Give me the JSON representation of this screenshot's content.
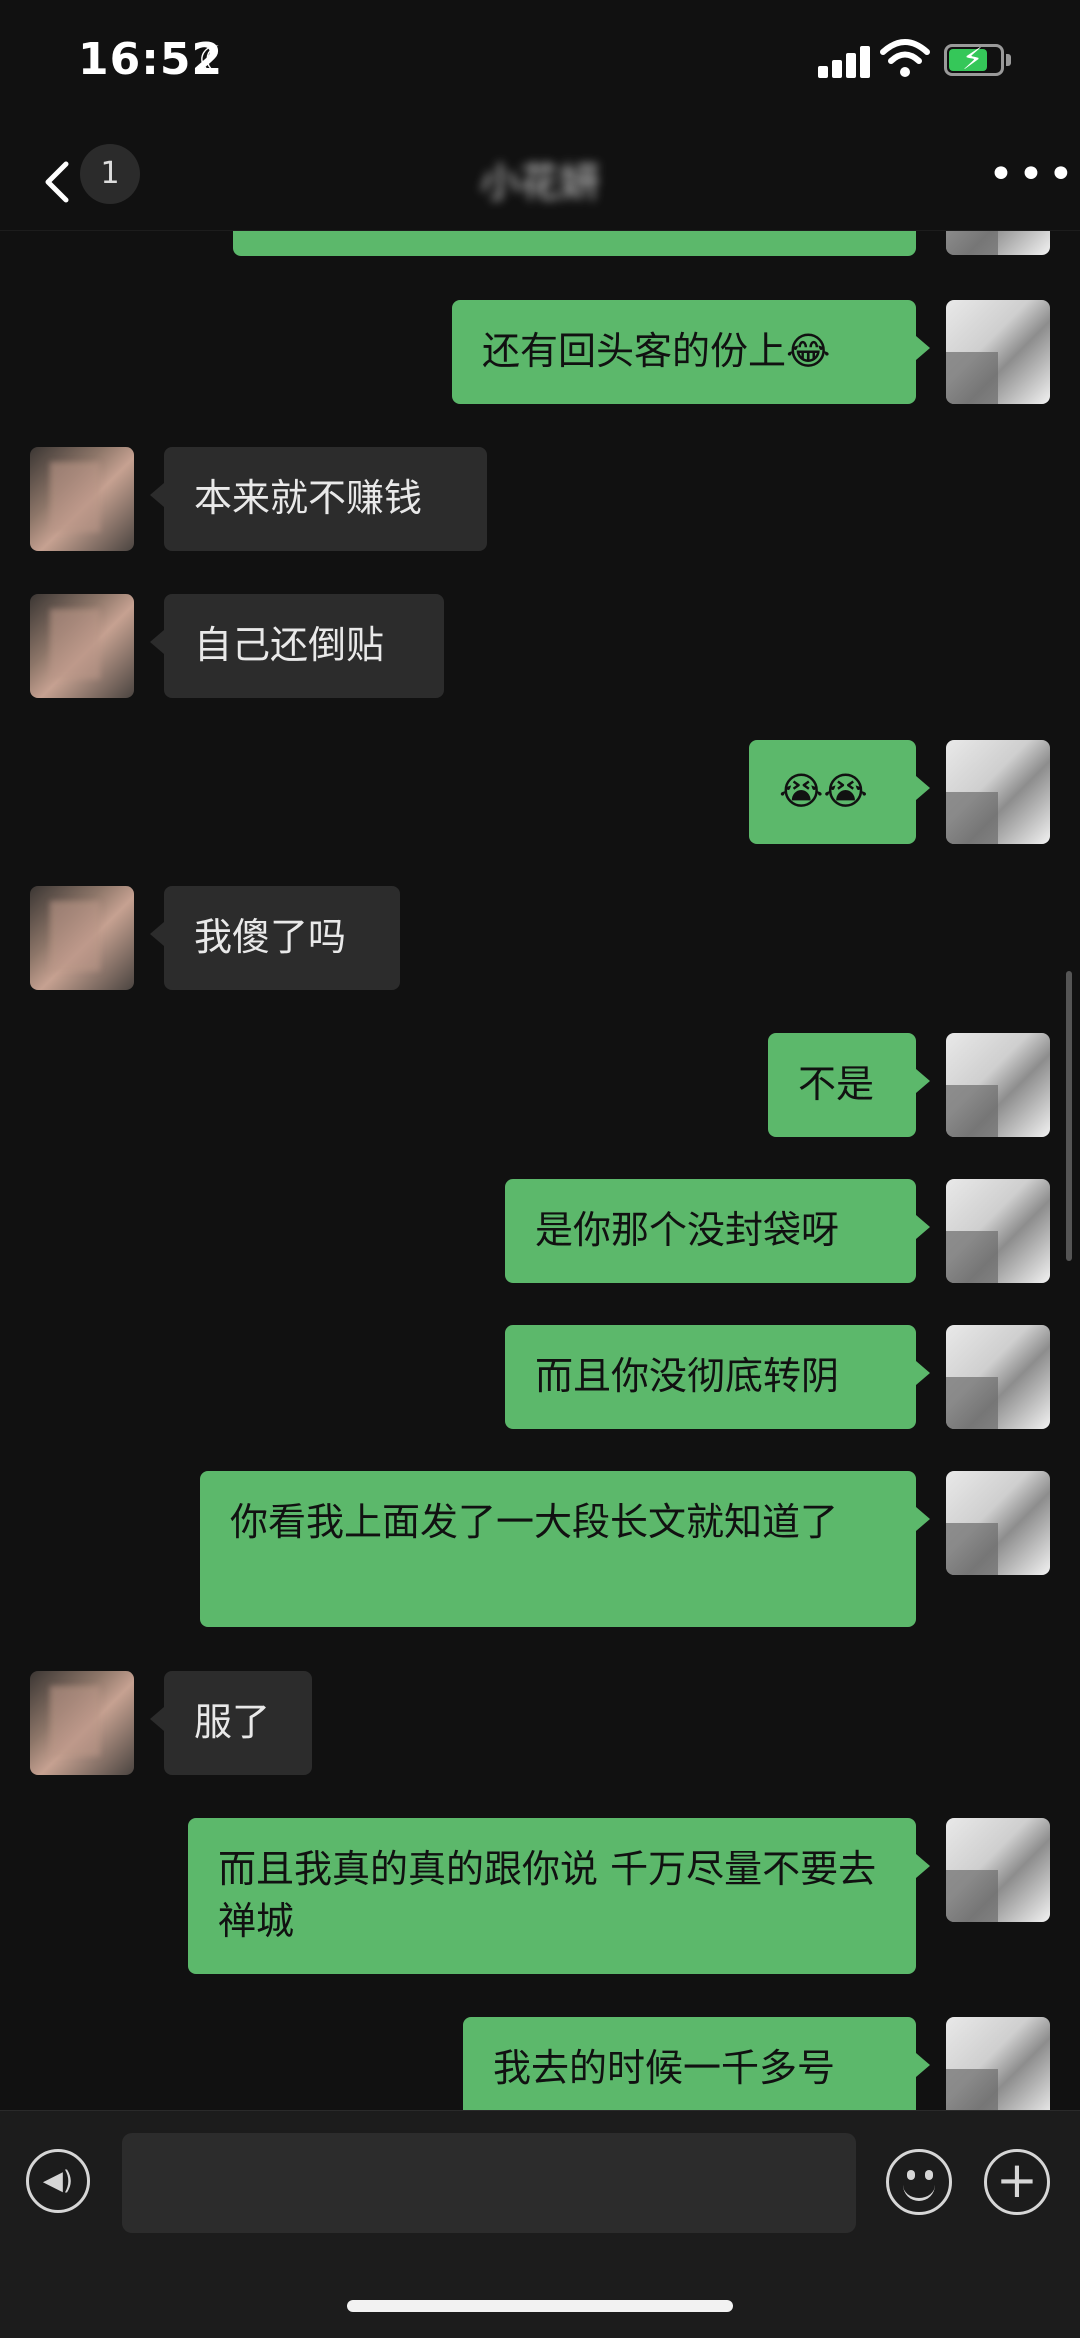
{
  "status": {
    "time": "16:52"
  },
  "nav": {
    "back_count": "1",
    "title": "小花妍"
  },
  "messages": [
    {
      "side": "me",
      "text": ""
    },
    {
      "side": "me",
      "text": "还有回头客的份上😂"
    },
    {
      "side": "them",
      "text": "本来就不赚钱"
    },
    {
      "side": "them",
      "text": "自己还倒贴"
    },
    {
      "side": "me",
      "text": "😭😭"
    },
    {
      "side": "them",
      "text": "我傻了吗"
    },
    {
      "side": "me",
      "text": "不是"
    },
    {
      "side": "me",
      "text": "是你那个没封袋呀"
    },
    {
      "side": "me",
      "text": "而且你没彻底转阴"
    },
    {
      "side": "me",
      "text": "你看我上面发了一大段长文就知道了"
    },
    {
      "side": "them",
      "text": "服了"
    },
    {
      "side": "me",
      "text": "而且我真的真的跟你说 千万尽量不要去禅城"
    },
    {
      "side": "me",
      "text": "我去的时候一千多号"
    }
  ],
  "colors": {
    "bubble_me": "#5cb86b",
    "bubble_them": "#2c2c2c",
    "bg": "#111111"
  }
}
